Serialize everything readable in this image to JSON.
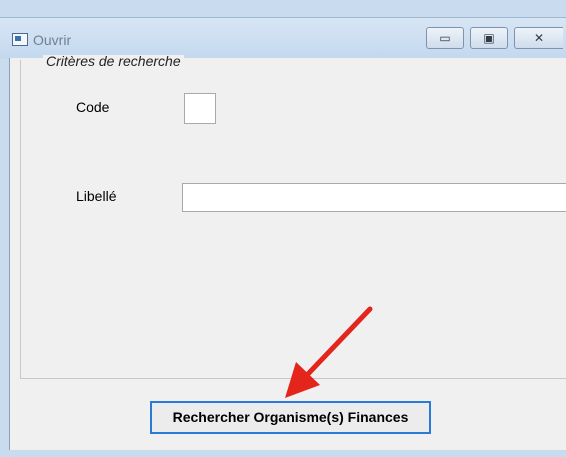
{
  "window": {
    "title": "Ouvrir",
    "controls": {
      "minimize": "▭",
      "maximize": "▣",
      "close": "✕"
    }
  },
  "criteria": {
    "group_label": "Critères de recherche",
    "code_label": "Code",
    "code_value": "",
    "libelle_label": "Libellé",
    "libelle_value": ""
  },
  "actions": {
    "search_label": "Rechercher Organisme(s) Finances"
  },
  "colors": {
    "arrow": "#e3251c",
    "focus_border": "#2a7bd8"
  },
  "icons": {
    "app": "app-window-icon",
    "annotation": "red-arrow-icon"
  }
}
